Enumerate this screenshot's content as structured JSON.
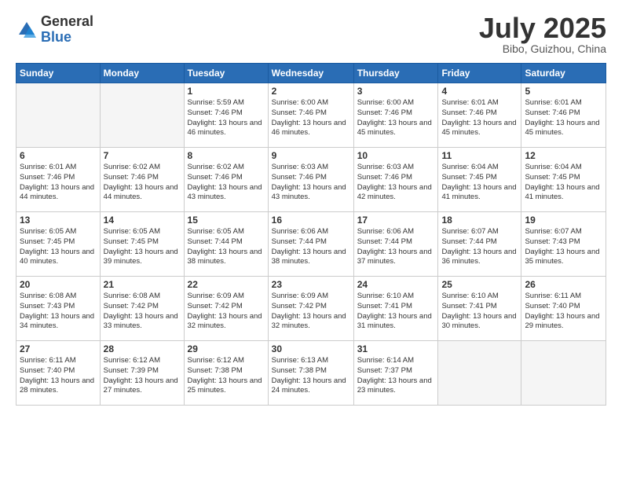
{
  "header": {
    "logo_general": "General",
    "logo_blue": "Blue",
    "title": "July 2025",
    "location": "Bibo, Guizhou, China"
  },
  "weekdays": [
    "Sunday",
    "Monday",
    "Tuesday",
    "Wednesday",
    "Thursday",
    "Friday",
    "Saturday"
  ],
  "weeks": [
    [
      {
        "day": "",
        "info": ""
      },
      {
        "day": "",
        "info": ""
      },
      {
        "day": "1",
        "info": "Sunrise: 5:59 AM\nSunset: 7:46 PM\nDaylight: 13 hours and 46 minutes."
      },
      {
        "day": "2",
        "info": "Sunrise: 6:00 AM\nSunset: 7:46 PM\nDaylight: 13 hours and 46 minutes."
      },
      {
        "day": "3",
        "info": "Sunrise: 6:00 AM\nSunset: 7:46 PM\nDaylight: 13 hours and 45 minutes."
      },
      {
        "day": "4",
        "info": "Sunrise: 6:01 AM\nSunset: 7:46 PM\nDaylight: 13 hours and 45 minutes."
      },
      {
        "day": "5",
        "info": "Sunrise: 6:01 AM\nSunset: 7:46 PM\nDaylight: 13 hours and 45 minutes."
      }
    ],
    [
      {
        "day": "6",
        "info": "Sunrise: 6:01 AM\nSunset: 7:46 PM\nDaylight: 13 hours and 44 minutes."
      },
      {
        "day": "7",
        "info": "Sunrise: 6:02 AM\nSunset: 7:46 PM\nDaylight: 13 hours and 44 minutes."
      },
      {
        "day": "8",
        "info": "Sunrise: 6:02 AM\nSunset: 7:46 PM\nDaylight: 13 hours and 43 minutes."
      },
      {
        "day": "9",
        "info": "Sunrise: 6:03 AM\nSunset: 7:46 PM\nDaylight: 13 hours and 43 minutes."
      },
      {
        "day": "10",
        "info": "Sunrise: 6:03 AM\nSunset: 7:46 PM\nDaylight: 13 hours and 42 minutes."
      },
      {
        "day": "11",
        "info": "Sunrise: 6:04 AM\nSunset: 7:45 PM\nDaylight: 13 hours and 41 minutes."
      },
      {
        "day": "12",
        "info": "Sunrise: 6:04 AM\nSunset: 7:45 PM\nDaylight: 13 hours and 41 minutes."
      }
    ],
    [
      {
        "day": "13",
        "info": "Sunrise: 6:05 AM\nSunset: 7:45 PM\nDaylight: 13 hours and 40 minutes."
      },
      {
        "day": "14",
        "info": "Sunrise: 6:05 AM\nSunset: 7:45 PM\nDaylight: 13 hours and 39 minutes."
      },
      {
        "day": "15",
        "info": "Sunrise: 6:05 AM\nSunset: 7:44 PM\nDaylight: 13 hours and 38 minutes."
      },
      {
        "day": "16",
        "info": "Sunrise: 6:06 AM\nSunset: 7:44 PM\nDaylight: 13 hours and 38 minutes."
      },
      {
        "day": "17",
        "info": "Sunrise: 6:06 AM\nSunset: 7:44 PM\nDaylight: 13 hours and 37 minutes."
      },
      {
        "day": "18",
        "info": "Sunrise: 6:07 AM\nSunset: 7:44 PM\nDaylight: 13 hours and 36 minutes."
      },
      {
        "day": "19",
        "info": "Sunrise: 6:07 AM\nSunset: 7:43 PM\nDaylight: 13 hours and 35 minutes."
      }
    ],
    [
      {
        "day": "20",
        "info": "Sunrise: 6:08 AM\nSunset: 7:43 PM\nDaylight: 13 hours and 34 minutes."
      },
      {
        "day": "21",
        "info": "Sunrise: 6:08 AM\nSunset: 7:42 PM\nDaylight: 13 hours and 33 minutes."
      },
      {
        "day": "22",
        "info": "Sunrise: 6:09 AM\nSunset: 7:42 PM\nDaylight: 13 hours and 32 minutes."
      },
      {
        "day": "23",
        "info": "Sunrise: 6:09 AM\nSunset: 7:42 PM\nDaylight: 13 hours and 32 minutes."
      },
      {
        "day": "24",
        "info": "Sunrise: 6:10 AM\nSunset: 7:41 PM\nDaylight: 13 hours and 31 minutes."
      },
      {
        "day": "25",
        "info": "Sunrise: 6:10 AM\nSunset: 7:41 PM\nDaylight: 13 hours and 30 minutes."
      },
      {
        "day": "26",
        "info": "Sunrise: 6:11 AM\nSunset: 7:40 PM\nDaylight: 13 hours and 29 minutes."
      }
    ],
    [
      {
        "day": "27",
        "info": "Sunrise: 6:11 AM\nSunset: 7:40 PM\nDaylight: 13 hours and 28 minutes."
      },
      {
        "day": "28",
        "info": "Sunrise: 6:12 AM\nSunset: 7:39 PM\nDaylight: 13 hours and 27 minutes."
      },
      {
        "day": "29",
        "info": "Sunrise: 6:12 AM\nSunset: 7:38 PM\nDaylight: 13 hours and 25 minutes."
      },
      {
        "day": "30",
        "info": "Sunrise: 6:13 AM\nSunset: 7:38 PM\nDaylight: 13 hours and 24 minutes."
      },
      {
        "day": "31",
        "info": "Sunrise: 6:14 AM\nSunset: 7:37 PM\nDaylight: 13 hours and 23 minutes."
      },
      {
        "day": "",
        "info": ""
      },
      {
        "day": "",
        "info": ""
      }
    ]
  ]
}
